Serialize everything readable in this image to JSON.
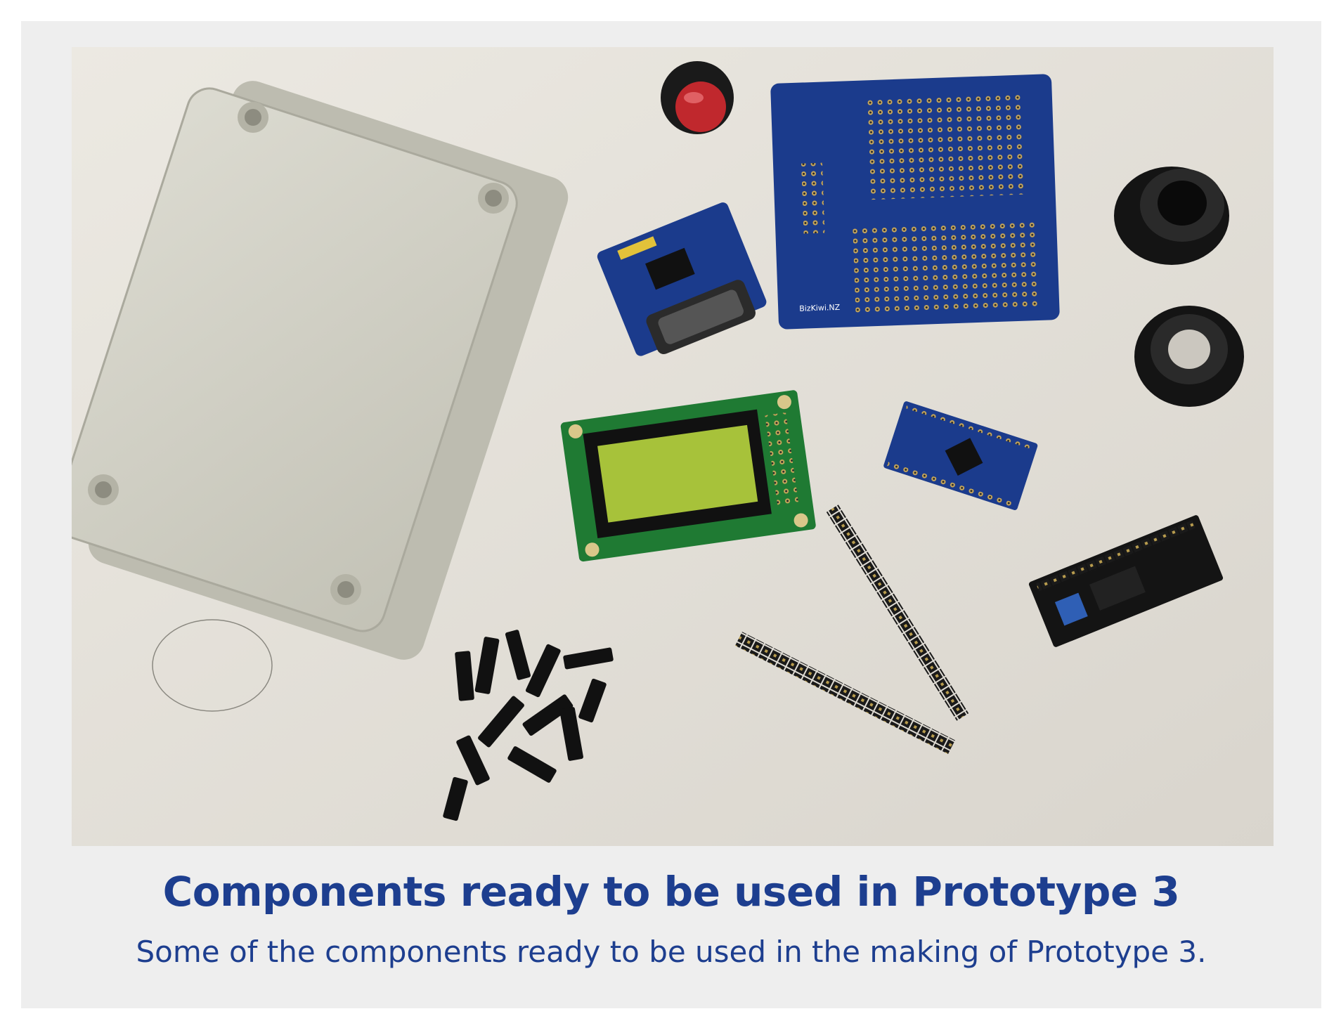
{
  "figure": {
    "title": "Components ready to be used in Prototype 3",
    "caption": "Some of the components ready to be used in the making of Prototype 3.",
    "board_label": "BizKiwi.NZ"
  },
  "colors": {
    "frame_background": "#eeeeee",
    "caption_text": "#1d3e8f",
    "table_surface": "#e6e3dc",
    "enclosure": "#d2d0c4",
    "protoboard": "#1b3b8c",
    "lcd_pcb": "#1f7a33",
    "lcd_screen": "#a7c23a",
    "button_cap": "#c0282d"
  }
}
